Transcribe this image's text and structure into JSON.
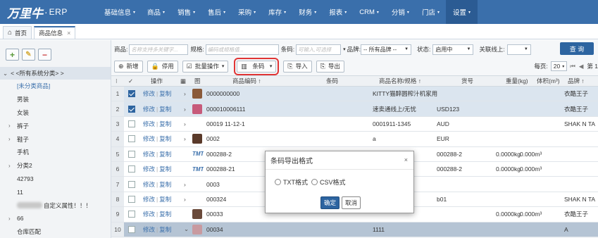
{
  "brand": {
    "logo_text": "万里牛",
    "sep": "·",
    "product": "ERP"
  },
  "nav": [
    {
      "label": "基础信息",
      "caret": "▾"
    },
    {
      "label": "商品",
      "caret": "▾"
    },
    {
      "label": "销售",
      "caret": "▾"
    },
    {
      "label": "售后",
      "caret": "▾"
    },
    {
      "label": "采购",
      "caret": "▾"
    },
    {
      "label": "库存",
      "caret": "▾"
    },
    {
      "label": "财务",
      "caret": "▾"
    },
    {
      "label": "报表",
      "caret": "▾"
    },
    {
      "label": "CRM",
      "caret": "▾"
    },
    {
      "label": "分销",
      "caret": "▾"
    },
    {
      "label": "门店",
      "caret": "▾"
    },
    {
      "label": "设置",
      "caret": "▾"
    }
  ],
  "tabs": [
    {
      "label": "首页",
      "icon": "⌂"
    },
    {
      "label": "商品信息",
      "close": "×"
    }
  ],
  "left": {
    "buttons": {
      "add": "+",
      "edit": "✎",
      "remove": "−"
    },
    "root": "< <所有系统分类> >",
    "nodes": [
      {
        "label": "[未分类商品]",
        "arrow": "",
        "link": true
      },
      {
        "label": "男装",
        "arrow": ""
      },
      {
        "label": "女装",
        "arrow": ""
      },
      {
        "label": "裤子",
        "arrow": "›"
      },
      {
        "label": "鞋子",
        "arrow": "›"
      },
      {
        "label": "手机",
        "arrow": ""
      },
      {
        "label": "分类2",
        "arrow": "›"
      },
      {
        "label": "42793",
        "arrow": ""
      },
      {
        "label": "11",
        "arrow": ""
      },
      {
        "label": "自定义属性！！！",
        "arrow": "",
        "blur": true
      },
      {
        "label": "66",
        "arrow": "›"
      },
      {
        "label": "仓库匹配",
        "arrow": ""
      }
    ]
  },
  "filter": {
    "product_label": "商品:",
    "product_placeholder": "名称支持多关键字...",
    "spec_label": "规格:",
    "spec_placeholder": "编码或规格值...",
    "barcode_label": "条码:",
    "barcode_placeholder": "可输入,可选择",
    "brand_label": "品牌:",
    "brand_value": "-- 所有品牌 --",
    "status_label": "状态:",
    "status_value": "启用中",
    "linked_label": "关联线上:",
    "linked_value": "",
    "query": "查 询"
  },
  "toolbar": [
    {
      "icon": "⊕",
      "label": "新增"
    },
    {
      "icon": "🔒",
      "label": "停用"
    },
    {
      "icon": "☑",
      "label": "批量操作",
      "caret": "▾"
    },
    {
      "icon": "▥",
      "label": "条码",
      "caret": "▾",
      "highlight": true
    },
    {
      "icon": "⎘",
      "label": "导入"
    },
    {
      "icon": "⎘",
      "label": "导出"
    }
  ],
  "pager": {
    "label": "每页:",
    "size": "20",
    "first": "⏮",
    "prev": "◀",
    "page": "第 1"
  },
  "grid": {
    "headers": {
      "menu": "⁝",
      "check": "✓",
      "ops": "操作",
      "img_icon": "▦",
      "img": "图",
      "code": "商品编码 ↑",
      "barcode": "条码",
      "name": "商品名称/规格 ↑",
      "sku": "货号",
      "weight": "重量(kg)",
      "volume": "体积(m³)",
      "brand": "品牌 ↑"
    },
    "rows": [
      {
        "n": "1",
        "checked": true,
        "edit": "修改",
        "copy": "复制",
        "expand": "›",
        "thumb": "t1",
        "code": "0000000000",
        "barcode": "",
        "name": "KITTY猫醉圆榨汁机家用",
        "sku": "",
        "weight": "",
        "volume": "",
        "brand": "衣酷王子"
      },
      {
        "n": "2",
        "checked": true,
        "edit": "修改",
        "copy": "复制",
        "expand": "›",
        "thumb": "t2",
        "code": "000010006111",
        "barcode": "",
        "name": "速卖通线上/无忧",
        "sku": "USD123",
        "weight": "",
        "volume": "",
        "brand": "衣酷王子"
      },
      {
        "n": "3",
        "checked": false,
        "edit": "修改",
        "copy": "复制",
        "expand": "›",
        "thumb": "",
        "code": "00019 11-12-1",
        "barcode": "",
        "name": "0001911-1345",
        "sku": "AUD",
        "weight": "",
        "volume": "",
        "brand": "SHAK N TA"
      },
      {
        "n": "4",
        "checked": false,
        "edit": "修改",
        "copy": "复制",
        "expand": "›",
        "thumb": "t3",
        "code": "0002",
        "barcode": "",
        "name": "a",
        "sku": "EUR",
        "weight": "",
        "volume": "",
        "brand": ""
      },
      {
        "n": "5",
        "checked": false,
        "edit": "修改",
        "copy": "复制",
        "expand": "",
        "thumb": "ico",
        "code": "000288-2",
        "barcode": "",
        "name": "",
        "sku": "000288-2",
        "weight": "0.0000kg",
        "volume": "0.000m³",
        "brand": ""
      },
      {
        "n": "6",
        "checked": false,
        "edit": "修改",
        "copy": "复制",
        "expand": "",
        "thumb": "ico",
        "code": "000288-21",
        "barcode": "",
        "name": "",
        "sku": "000288-2",
        "weight": "0.0000kg",
        "volume": "0.000m³",
        "brand": ""
      },
      {
        "n": "7",
        "checked": false,
        "edit": "修改",
        "copy": "复制",
        "expand": "›",
        "thumb": "",
        "code": "0003",
        "barcode": "",
        "name": "",
        "sku": "",
        "weight": "",
        "volume": "",
        "brand": ""
      },
      {
        "n": "8",
        "checked": false,
        "edit": "修改",
        "copy": "复制",
        "expand": "›",
        "thumb": "",
        "code": "000324",
        "barcode": "",
        "name": "",
        "sku": "b01",
        "weight": "",
        "volume": "",
        "brand": "SHAK N TA"
      },
      {
        "n": "9",
        "checked": false,
        "edit": "修改",
        "copy": "复制",
        "expand": "",
        "thumb": "t4",
        "code": "00033",
        "barcode": "",
        "name": "",
        "sku": "",
        "weight": "0.0000kg",
        "volume": "0.000m³",
        "brand": "衣酷王子"
      },
      {
        "n": "10",
        "checked": false,
        "edit": "修改",
        "copy": "复制",
        "expand": "⌄",
        "thumb": "t5",
        "code": "00034",
        "barcode": "",
        "name": "1111",
        "sku": "",
        "weight": "",
        "volume": "",
        "brand": "A"
      }
    ],
    "icon_label": "TMT"
  },
  "modal": {
    "title": "条码导出格式",
    "close": "×",
    "opt_txt": "TXT格式",
    "opt_csv": "CSV格式",
    "ok": "确定",
    "cancel": "取消"
  }
}
